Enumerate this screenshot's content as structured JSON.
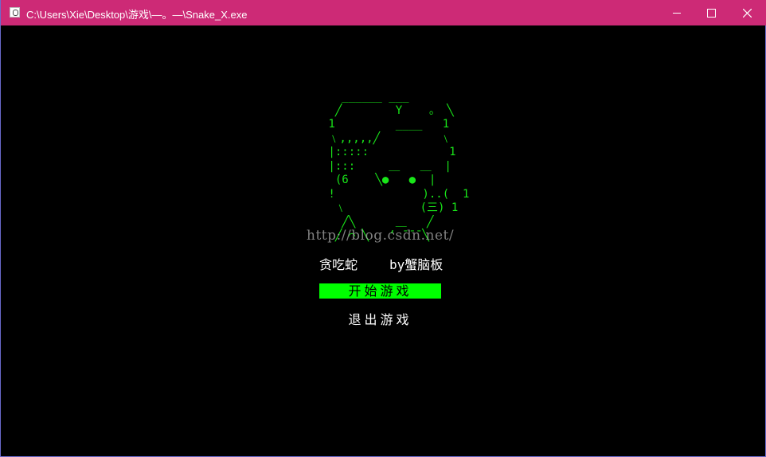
{
  "window": {
    "title": "C:\\Users\\Xie\\Desktop\\游戏\\—。—\\Snake_X.exe",
    "icon": "console-app-icon",
    "controls": [
      "minimize-icon",
      "maximize-icon",
      "close-icon"
    ]
  },
  "colors": {
    "titlebar": "#cd2a76",
    "background": "#000000",
    "art": "#19e619",
    "selected_bg": "#00ff00",
    "text": "#ffffff"
  },
  "ascii_art": "   ______ ___\n  ╱        Y    。 ╲\n 1         ____   1\n ﹨,,,,,╱         ﹨\n |:::::            1\n |:::     ＿   ＿  |\n  (6    ╲●   ●  |\n !             )..(  1\n  ﹨           (三) 1\n   ╱╲      ＿   ╱\n  ╱ ⌒ ╲   ‘ ̄ ̄ ̄ ╲",
  "watermark": "http://blog.csdn.net/",
  "game": {
    "title": "贪吃蛇",
    "author": "by蟹脑板"
  },
  "menu": {
    "items": [
      "开始游戏",
      "退出游戏"
    ],
    "selected": "开始游戏"
  }
}
